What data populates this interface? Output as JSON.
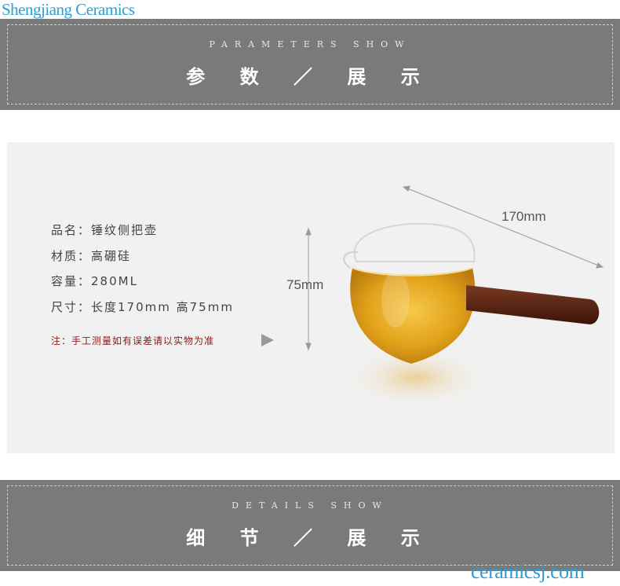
{
  "watermark_top": "Shengjiang Ceramics",
  "watermark_bottom": "ceramicsj.com",
  "parameters": {
    "en": "PARAMETERS SHOW",
    "cn": "参 数 ／ 展 示"
  },
  "specs": [
    "品名：锤纹侧把壶",
    "材质：高硼硅",
    "容量：280ML",
    "尺寸：长度170mm 高75mm"
  ],
  "note": "注：手工测量如有误差请以实物为准",
  "dimensions": {
    "height": "75mm",
    "length": "170mm"
  },
  "details": {
    "en": "DETAILS SHOW",
    "cn": "细 节 ／ 展 示"
  },
  "colors": {
    "banner": "#7a7a7a",
    "panel": "#f1f1f1",
    "note": "#8a1a1a",
    "watermark": "#2a9fd6"
  }
}
